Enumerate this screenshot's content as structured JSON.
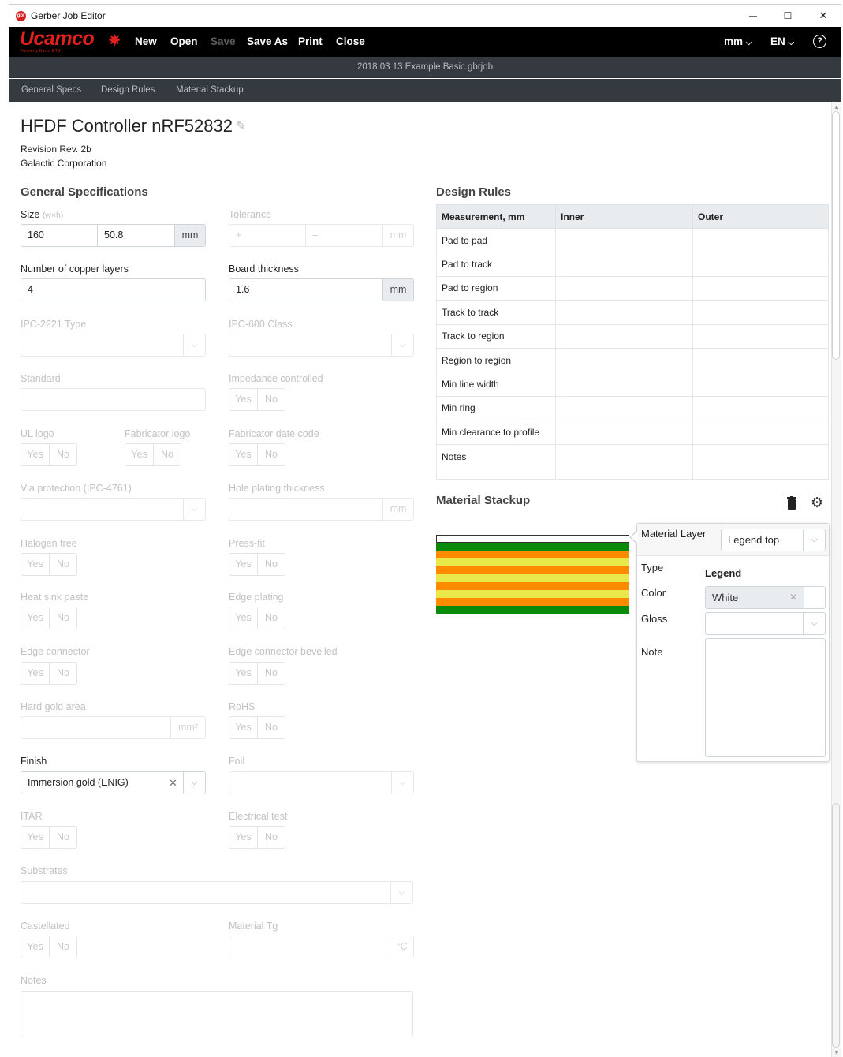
{
  "window": {
    "title": "Gerber Job Editor",
    "minimize": "─",
    "maximize": "☐",
    "close": "✕"
  },
  "menu": {
    "logo": "Ucamco",
    "logo_sub": "Formerly Barco ETS",
    "items": [
      "New",
      "Open",
      "Save",
      "Save As",
      "Print",
      "Close"
    ],
    "disabled": [
      "Save"
    ],
    "units": "mm",
    "language": "EN",
    "help": "?"
  },
  "file": {
    "name": "2018 03 13 Example Basic.gbrjob"
  },
  "tabs": [
    "General Specs",
    "Design Rules",
    "Material Stackup"
  ],
  "board": {
    "title": "HFDF Controller nRF52832",
    "revision": "Revision Rev. 2b",
    "company": "Galactic Corporation"
  },
  "general": {
    "title": "General Specifications",
    "size_label": "Size",
    "size_hint": "(w×h)",
    "size_w": "160",
    "size_h": "50.8",
    "size_unit": "mm",
    "tolerance_label": "Tolerance",
    "tolerance_plus": "+",
    "tolerance_minus": "–",
    "tolerance_unit": "mm",
    "copper_label": "Number of copper layers",
    "copper_value": "4",
    "thickness_label": "Board thickness",
    "thickness_value": "1.6",
    "thickness_unit": "mm",
    "ipc2221_label": "IPC-2221 Type",
    "ipc600_label": "IPC-600 Class",
    "standard_label": "Standard",
    "impedance_label": "Impedance controlled",
    "ul_logo_label": "UL logo",
    "fab_logo_label": "Fabricator logo",
    "fab_date_label": "Fabricator date code",
    "via_label": "Via protection (IPC-4761)",
    "hole_plating_label": "Hole plating thickness",
    "hole_plating_unit": "mm",
    "halogen_label": "Halogen free",
    "pressfit_label": "Press-fit",
    "heatsink_label": "Heat sink paste",
    "edge_plating_label": "Edge plating",
    "edge_conn_label": "Edge connector",
    "edge_bevel_label": "Edge connector bevelled",
    "hard_gold_label": "Hard gold area",
    "hard_gold_unit": "mm²",
    "rohs_label": "RoHS",
    "finish_label": "Finish",
    "finish_value": "Immersion gold (ENIG)",
    "foil_label": "Foil",
    "itar_label": "ITAR",
    "etest_label": "Electrical test",
    "substrates_label": "Substrates",
    "castellated_label": "Castellated",
    "tg_label": "Material Tg",
    "tg_unit": "°C",
    "notes_label": "Notes",
    "yes": "Yes",
    "no": "No"
  },
  "design_rules": {
    "title": "Design Rules",
    "headers": [
      "Measurement, mm",
      "Inner",
      "Outer"
    ],
    "rows": [
      "Pad to pad",
      "Pad to track",
      "Pad to region",
      "Track to track",
      "Track to region",
      "Region to region",
      "Min line width",
      "Min ring",
      "Min clearance to profile",
      "Notes"
    ]
  },
  "stackup": {
    "title": "Material Stackup",
    "layer_colors": [
      "#ffffff",
      "#0a8a0a",
      "#ff8c00",
      "#e8e84a",
      "#ff8c00",
      "#e8e84a",
      "#ff8c00",
      "#e8e84a",
      "#ff8c00",
      "#0a8a0a"
    ],
    "popover": {
      "layer_label": "Material Layer",
      "layer_value": "Legend top",
      "type_label": "Type",
      "type_value": "Legend",
      "color_label": "Color",
      "color_value": "White",
      "gloss_label": "Gloss",
      "note_label": "Note"
    }
  }
}
